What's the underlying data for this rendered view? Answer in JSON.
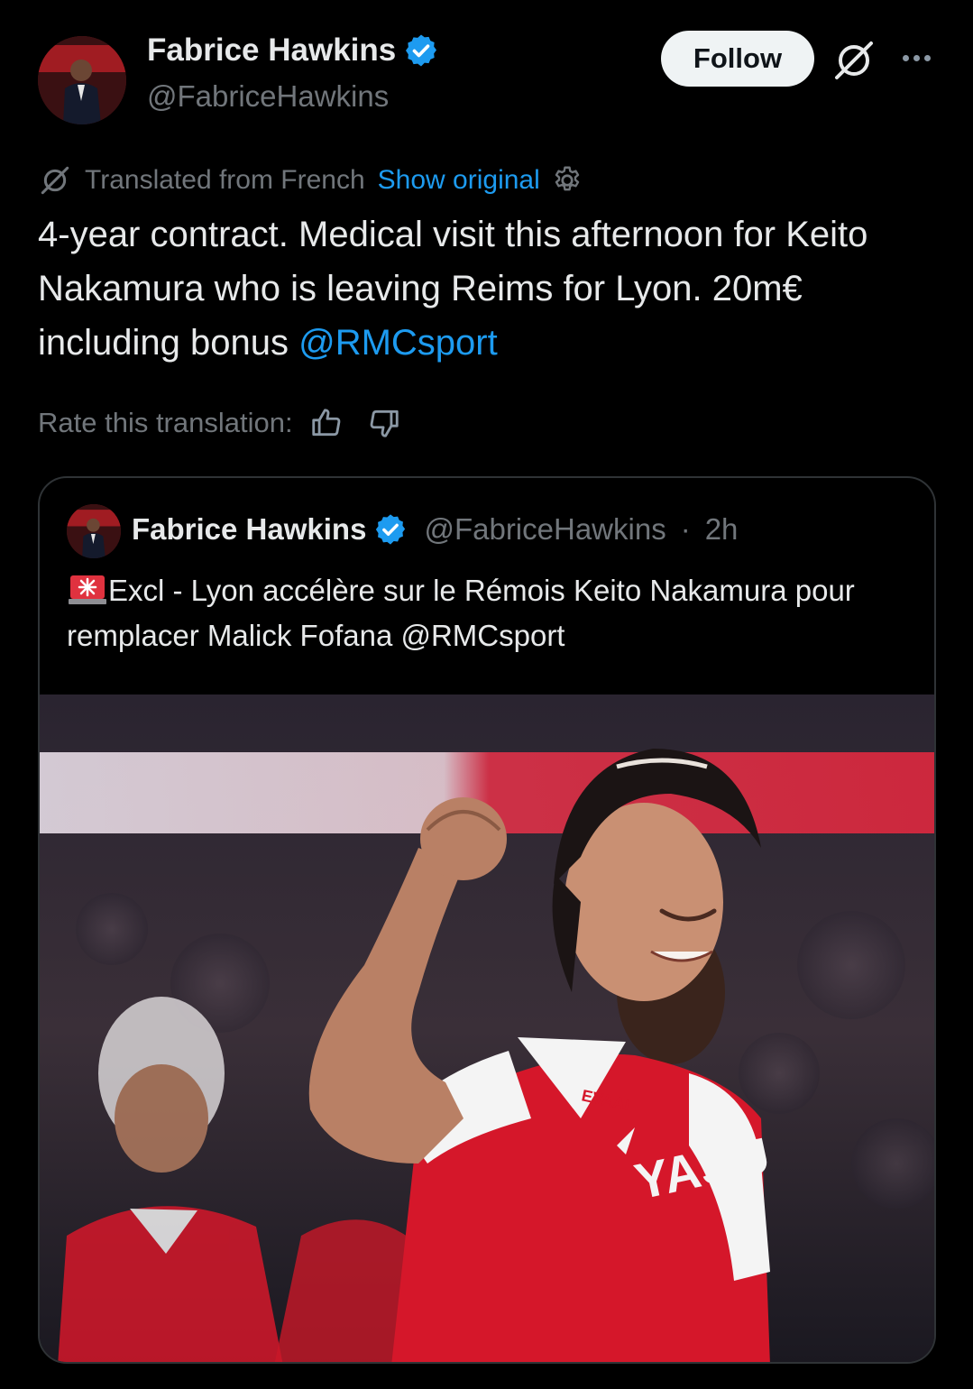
{
  "author": {
    "display_name": "Fabrice Hawkins",
    "handle": "@FabriceHawkins",
    "verified": true
  },
  "actions": {
    "follow_label": "Follow",
    "grok_icon": "grok-icon",
    "more_icon": "more-icon"
  },
  "translation": {
    "translated_label": "Translated from French",
    "show_original_label": "Show original",
    "settings_icon": "gear-icon"
  },
  "tweet": {
    "text": "4-year contract. Medical visit this afternoon for Keito Nakamura who is leaving Reims for Lyon. 20m€ including bonus ",
    "mention": "@RMCsport"
  },
  "rating": {
    "label": "Rate this translation:",
    "icons": [
      "thumbs-up-icon",
      "thumbs-down-icon"
    ]
  },
  "quoted_tweet": {
    "display_name": "Fabrice Hawkins",
    "handle": "@FabriceHawkins",
    "separator": "·",
    "time": "2h",
    "text_line": "Excl - Lyon accélère sur le Rémois  Keito Nakamura pour remplacer Malick Fofana @RMCsport",
    "emoji_icon": "siren-icon"
  },
  "colors": {
    "background": "#000000",
    "primary_text": "#e7e9ea",
    "secondary_text": "#71767b",
    "link": "#1d9bf0",
    "verified": "#1d9bf0",
    "jersey_red": "#d5172a"
  }
}
